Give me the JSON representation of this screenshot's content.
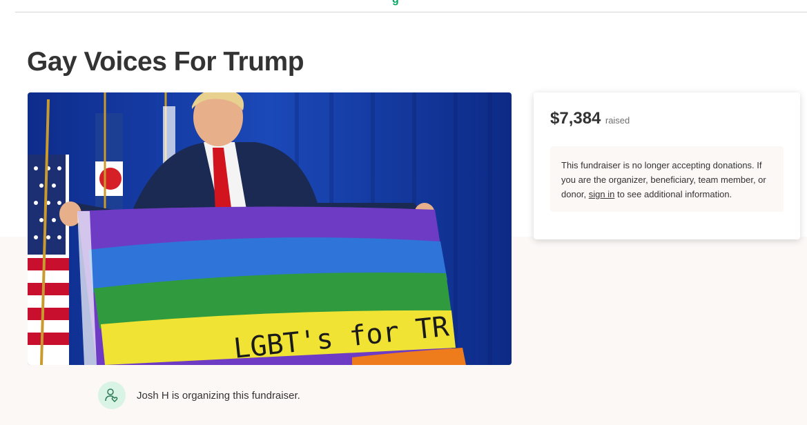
{
  "header": {
    "logo_fragment": "g"
  },
  "campaign": {
    "title": "Gay Voices For Trump",
    "hero_image": "Man in suit holding rainbow flag reading LGBT's for TR",
    "flag_text": "LGBT's for TR"
  },
  "donation": {
    "amount": "$7,384",
    "raised_label": "raised",
    "notice_before": "This fundraiser is no longer accepting donations. If you are the organizer, beneficiary, team member, or donor, ",
    "sign_in_label": "sign in",
    "notice_after": " to see additional information."
  },
  "organizer": {
    "icon": "person-heart-icon",
    "text": "Josh H is organizing this fundraiser."
  },
  "colors": {
    "brand_green": "#02a95c",
    "beige": "#fbf8f6",
    "avatar_bg": "#d9f3e5"
  }
}
